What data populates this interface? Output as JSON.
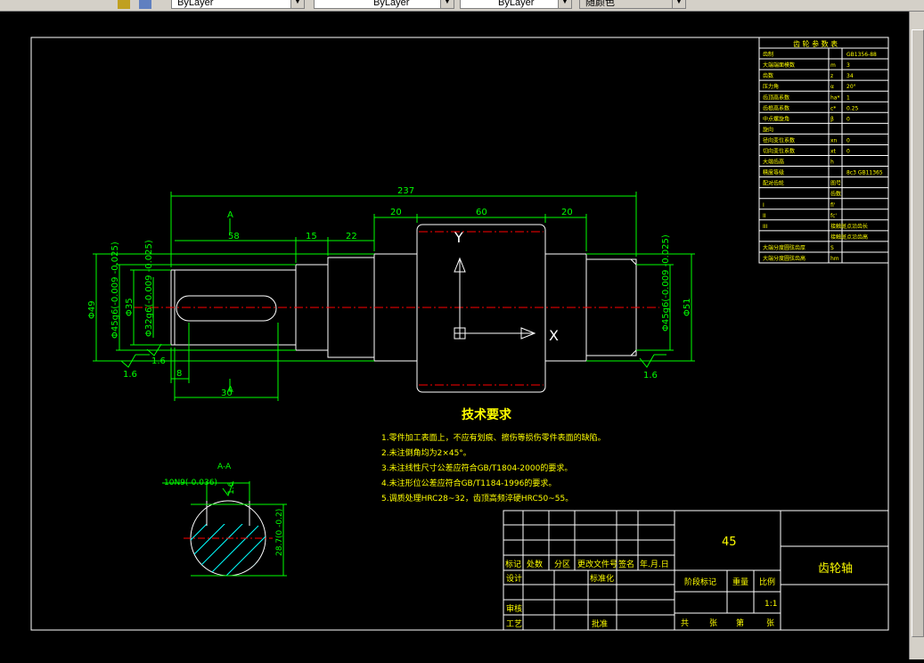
{
  "toolbar": {
    "layer_color": "ByLayer",
    "layer_linetype": "ByLayer",
    "layer_lineweight": "ByLayer",
    "plot_style": "随颜色"
  },
  "dimensions": {
    "overall_length": "237",
    "seg_20_left": "20",
    "seg_60": "60",
    "seg_20_right": "20",
    "seg_58": "58",
    "seg_15": "15",
    "seg_22": "22",
    "dim_8": "8",
    "dim_30": "30",
    "dia_phi49": "Φ49",
    "dia_phi35": "Φ35",
    "dia_phi45_left": "Φ45g6(-0.009\n-0.025)",
    "dia_phi32": "Φ32g6(-0.009\n-0.025)",
    "dia_phi45_right": "Φ45g6(-0.009\n-0.025)",
    "dia_phi51": "Φ51",
    "section_label_a": "A",
    "section_label_a2": "A",
    "ra_left_1": "1.6",
    "ra_left_2": "1.6",
    "ra_right": "1.6",
    "section_title": "A-A",
    "keyway_spec": "10N9(-0.036)",
    "keyway_ra": "1.6",
    "keyway_depth": "28.7(0\n-0.2)",
    "axis_y": "Y",
    "axis_x": "X"
  },
  "tech_requirements": {
    "title": "技术要求",
    "items": [
      "1.零件加工表面上，不应有划痕、擦伤等损伤零件表面的缺陷。",
      "2.未注倒角均为2×45°。",
      "3.未注线性尺寸公差应符合GB/T1804-2000的要求。",
      "4.未注形位公差应符合GB/T1184-1996的要求。",
      "5.调质处理HRC28~32，齿顶高频淬硬HRC50~55。"
    ]
  },
  "gear_table": {
    "title": "齿 轮 参 数 表",
    "rows": [
      {
        "name": "齿制",
        "sym": "",
        "val": "GB1356-88"
      },
      {
        "name": "大端端面模数",
        "sym": "m",
        "val": "3"
      },
      {
        "name": "齿数",
        "sym": "z",
        "val": "34"
      },
      {
        "name": "压力角",
        "sym": "α",
        "val": "20°"
      },
      {
        "name": "齿顶高系数",
        "sym": "ha*",
        "val": "1"
      },
      {
        "name": "齿根高系数",
        "sym": "c*",
        "val": "0.25"
      },
      {
        "name": "中点螺旋角",
        "sym": "β",
        "val": "0"
      },
      {
        "name": "旋向",
        "sym": "",
        "val": ""
      },
      {
        "name": "径向变位系数",
        "sym": "xn",
        "val": "0"
      },
      {
        "name": "切向变位系数",
        "sym": "xt",
        "val": "0"
      },
      {
        "name": "大端齿高",
        "sym": "h",
        "val": ""
      },
      {
        "name": "精度等级",
        "sym": "",
        "val": "8c3 GB11365"
      },
      {
        "name": "配对齿轮",
        "sym": "图号",
        "val": ""
      },
      {
        "name": "",
        "sym": "齿数",
        "val": ""
      },
      {
        "name": "I",
        "sym": "fi'",
        "val": ""
      },
      {
        "name": "II",
        "sym": "fc'",
        "val": ""
      },
      {
        "name": "III",
        "sym": "接触斑点沿齿长",
        "val": ""
      },
      {
        "name": "",
        "sym": "接触斑点沿齿高",
        "val": ""
      },
      {
        "name": "大端分度圆弦齿厚",
        "sym": "S",
        "val": ""
      },
      {
        "name": "大端分度圆弦齿高",
        "sym": "hm",
        "val": ""
      }
    ]
  },
  "title_block": {
    "material": "45",
    "part_name": "齿轮轴",
    "scale": "1:1",
    "labels": {
      "mark": "标记",
      "count": "处数",
      "zone": "分区",
      "change_doc": "更改文件号",
      "sign": "签名",
      "date": "年.月.日",
      "design": "设计",
      "standardize": "标准化",
      "stage_mark": "阶段标记",
      "weight": "重量",
      "ratio": "比例",
      "review": "审核",
      "process": "工艺",
      "approve": "批准",
      "total": "共",
      "sheets": "张",
      "page": "第",
      "page_sheets": "张"
    }
  },
  "colors": {
    "background": "#000000",
    "outline": "#ffffff",
    "dimension": "#00ff00",
    "centerline": "#ff0000",
    "hatch": "#00ffff",
    "text": "#ffff00"
  }
}
